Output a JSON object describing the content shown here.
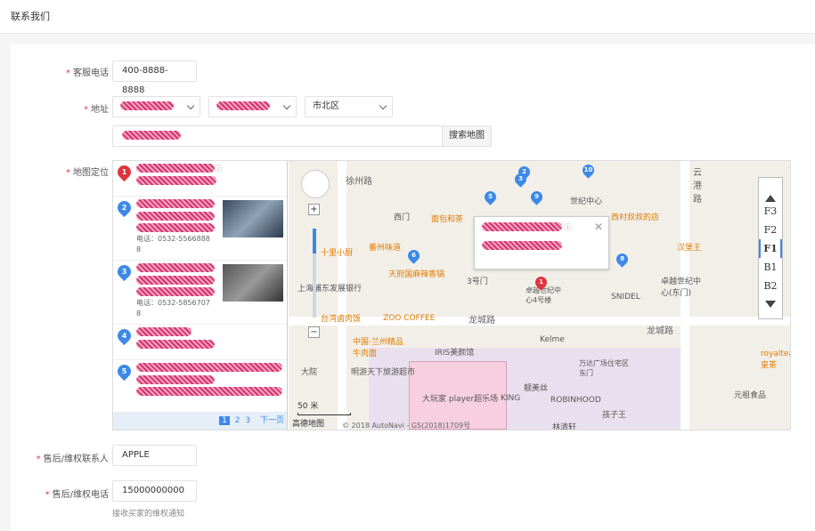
{
  "header": {
    "title": "联系我们"
  },
  "form": {
    "service_phone": {
      "label": "客服电话",
      "value": "400-8888-8888"
    },
    "address": {
      "label": "地址",
      "district": "市北区",
      "search_button": "搜索地图"
    },
    "map_location": {
      "label": "地图定位"
    },
    "after_sales_contact": {
      "label": "售后/维权联系人",
      "value": "APPLE"
    },
    "after_sales_phone": {
      "label": "售后/维权电话",
      "value": "15000000000",
      "hint": "接收买家的维权通知"
    }
  },
  "results": [
    {
      "num": "1",
      "color": "red"
    },
    {
      "num": "2",
      "color": "blue",
      "phone": "电话：0532-5566888",
      "phone_cont": "8"
    },
    {
      "num": "3",
      "color": "blue",
      "phone": "电话：0532-5856707",
      "phone_cont": "8"
    },
    {
      "num": "4",
      "color": "blue"
    },
    {
      "num": "5",
      "color": "blue"
    }
  ],
  "pager": {
    "pages": [
      "1",
      "2",
      "3"
    ],
    "next": "下一页"
  },
  "map": {
    "labels": [
      "徐州路",
      "西门",
      "面包和茶",
      "世纪中心",
      "西村叔叔的店",
      "汉堡王",
      "十里小厨",
      "番州味道",
      "天府国麻辣香锅",
      "3号门",
      "卓越世纪中心4号楼",
      "SNIDEL",
      "卓越世纪中心(东门)",
      "上海浦东发展银行",
      "台湾卤肉饭",
      "ZOO COFFEE",
      "龙城路",
      "中国·兰州精品牛肉面",
      "IRIS美颜馆",
      "Kelme",
      "万达广场住宅区东门",
      "明游天下旅游超市",
      "大玩家 player超乐场",
      "KING",
      "靓美丝",
      "ROBINHOOD",
      "孩子王",
      "林清轩",
      "royaltea皇茶",
      "元祖食品",
      "云港路",
      "大院"
    ],
    "scale": "50 米",
    "logo": "高德地图",
    "copyright": "© 2018 AutoNavi - GS(2018)1709号",
    "floors": [
      "F3",
      "F2",
      "F1",
      "B1",
      "B2"
    ],
    "active_floor": "F1",
    "pins": [
      "2",
      "3",
      "5",
      "9",
      "10",
      "6",
      "8",
      "1"
    ]
  }
}
